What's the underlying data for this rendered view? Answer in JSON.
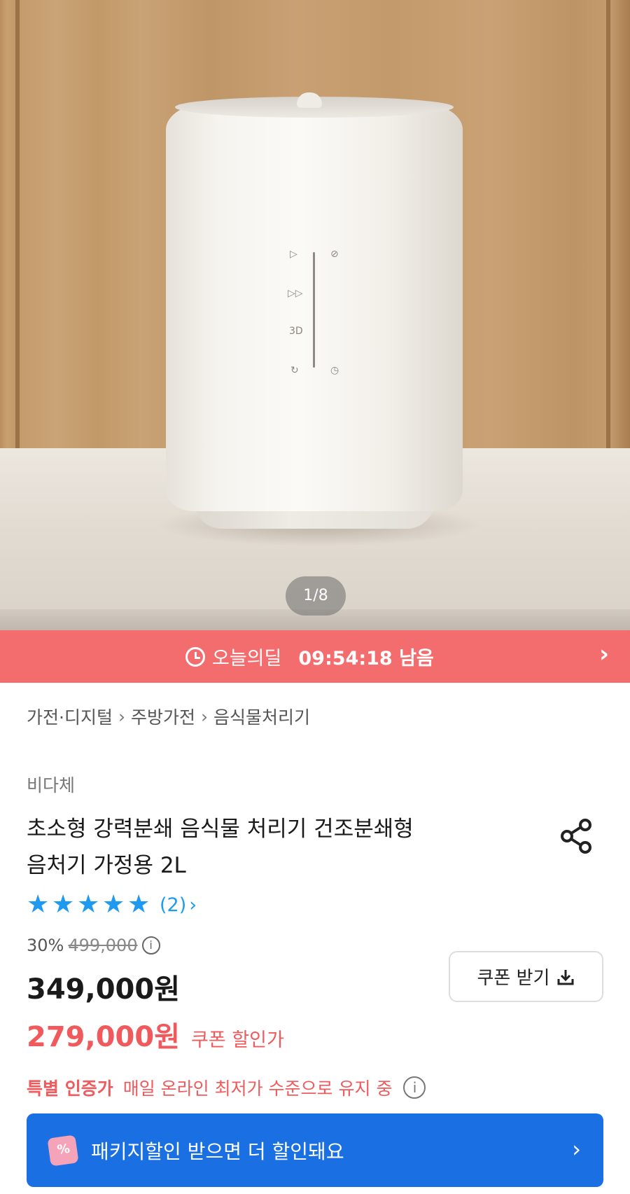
{
  "gallery": {
    "counter": "1/8",
    "panel_icons": [
      "▷",
      "⊘",
      "▷▷",
      "3D",
      "↻",
      "◷"
    ]
  },
  "deal_bar": {
    "icon": "clock-icon",
    "label": "오늘의딜",
    "time_left": "09:54:18 남음",
    "arrow": "›"
  },
  "breadcrumb": [
    "가전·디지털",
    "주방가전",
    "음식물처리기"
  ],
  "product": {
    "brand": "비다체",
    "title_line1": "초소형 강력분쇄 음식물 처리기 건조분쇄형",
    "title_line2": "음처기 가정용 2L",
    "rating": {
      "stars": 5,
      "max": 5,
      "review_count": "(2)",
      "chevron": "›"
    },
    "discount_percent": "30%",
    "original_price": "499,000",
    "price": "349,000원",
    "coupon_price": "279,000원",
    "coupon_price_label": "쿠폰 할인가",
    "coupon_button": "쿠폰 받기",
    "special": {
      "label": "특별 인증가",
      "description": "매일 온라인 최저가 수준으로 유지 중",
      "info": "i"
    },
    "package_banner": {
      "text": "패키지할인 받으면 더 할인돼요",
      "arrow": "›"
    }
  },
  "colors": {
    "deal_bar": "#f36d6e",
    "accent_red": "#f05a5c",
    "star_blue": "#1e9bf0",
    "banner_blue": "#1a6fe3"
  }
}
